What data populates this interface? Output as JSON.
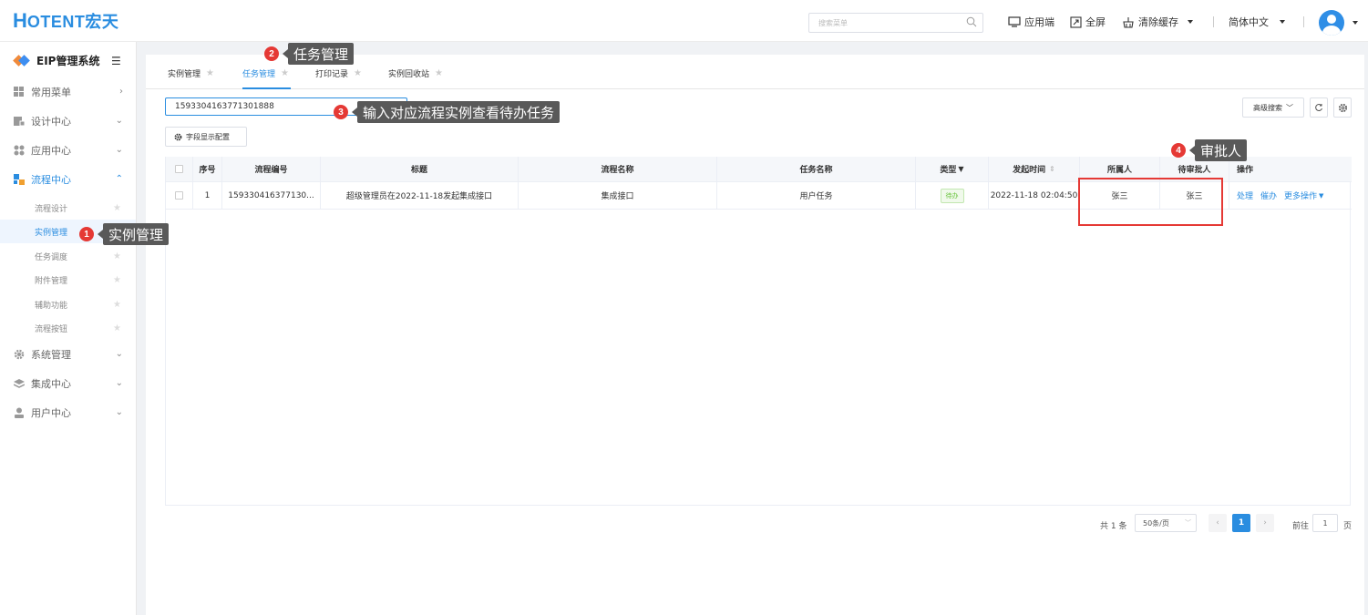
{
  "header": {
    "logo_letter": "H",
    "logo_text": "OTENT宏天",
    "search_placeholder": "搜索菜单",
    "app_label": "应用端",
    "fullscreen_label": "全屏",
    "clear_cache_label": "清除缓存",
    "language_label": "简体中文"
  },
  "sidebar": {
    "title": "EIP管理系统",
    "menus": [
      {
        "label": "常用菜单",
        "arrow": "›"
      },
      {
        "label": "设计中心",
        "arrow": "⌄"
      },
      {
        "label": "应用中心",
        "arrow": "⌄"
      },
      {
        "label": "流程中心",
        "arrow": "⌃"
      },
      {
        "label": "系统管理",
        "arrow": "⌄"
      },
      {
        "label": "集成中心",
        "arrow": "⌄"
      },
      {
        "label": "用户中心",
        "arrow": "⌄"
      }
    ],
    "sub_items": [
      "流程设计",
      "实例管理",
      "任务调度",
      "附件管理",
      "辅助功能",
      "流程按钮"
    ]
  },
  "tabs": [
    "实例管理",
    "任务管理",
    "打印记录",
    "实例回收站"
  ],
  "toolbar": {
    "instance_input_value": "1593304163771301888",
    "field_config_label": "字段显示配置",
    "advanced_search_label": "高级搜索"
  },
  "table": {
    "headers": [
      "序号",
      "流程编号",
      "标题",
      "流程名称",
      "任务名称",
      "类型",
      "发起时间",
      "所属人",
      "待审批人",
      "操作"
    ],
    "rows": [
      {
        "index": "1",
        "process_no": "159330416377130...",
        "title": "超级管理员在2022-11-18发起集成接口",
        "process_name": "集成接口",
        "task_name": "用户任务",
        "type": "待办",
        "start_time": "2022-11-18 02:04:50",
        "owner": "张三",
        "approver": "张三",
        "ops": [
          "处理",
          "催办",
          "更多操作"
        ]
      }
    ]
  },
  "pagination": {
    "total_label": "共 1 条",
    "page_size_label": "50条/页",
    "current_page": "1",
    "goto_label": "前往",
    "goto_value": "1",
    "page_unit": "页"
  },
  "annotations": [
    {
      "number": "1",
      "text": "实例管理"
    },
    {
      "number": "2",
      "text": "任务管理"
    },
    {
      "number": "3",
      "text": "输入对应流程实例查看待办任务"
    },
    {
      "number": "4",
      "text": "审批人"
    }
  ],
  "colors": {
    "accent": "#2a8de0",
    "annotation_badge": "#e53935",
    "callout_bg": "#595959",
    "pending_tag": "#67c23a"
  }
}
